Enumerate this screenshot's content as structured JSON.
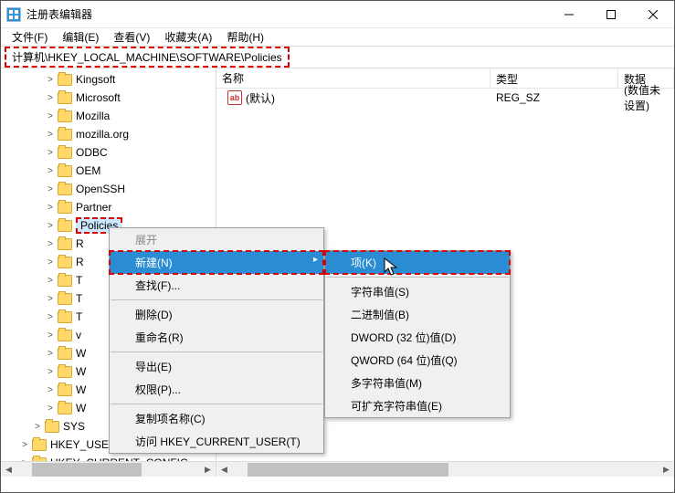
{
  "window": {
    "title": "注册表编辑器"
  },
  "menu": {
    "file": "文件(F)",
    "edit": "编辑(E)",
    "view": "查看(V)",
    "favorites": "收藏夹(A)",
    "help": "帮助(H)"
  },
  "address_path": "计算机\\HKEY_LOCAL_MACHINE\\SOFTWARE\\Policies",
  "tree": {
    "items": [
      "Kingsoft",
      "Microsoft",
      "Mozilla",
      "mozilla.org",
      "ODBC",
      "OEM",
      "OpenSSH",
      "Partner",
      "Policies"
    ],
    "truncated": [
      "R",
      "R",
      "T",
      "T",
      "T",
      "v",
      "W",
      "W",
      "W",
      "W"
    ],
    "sys": "SYS",
    "hku": "HKEY_USERS",
    "hkcc": "HKEY_CURRENT_CONFIG"
  },
  "columns": {
    "name": "名称",
    "type": "类型",
    "data": "数据"
  },
  "value_row": {
    "icon_text": "ab",
    "name": "(默认)",
    "type": "REG_SZ",
    "data": "(数值未设置)"
  },
  "ctx1": {
    "expand": "展开",
    "new": "新建(N)",
    "find": "查找(F)...",
    "delete": "删除(D)",
    "rename": "重命名(R)",
    "export": "导出(E)",
    "perm": "权限(P)...",
    "copyname": "复制项名称(C)",
    "goto": "访问 HKEY_CURRENT_USER(T)"
  },
  "ctx2": {
    "key": "项(K)",
    "string": "字符串值(S)",
    "binary": "二进制值(B)",
    "dword": "DWORD (32 位)值(D)",
    "qword": "QWORD (64 位)值(Q)",
    "multi": "多字符串值(M)",
    "expand": "可扩充字符串值(E)"
  }
}
